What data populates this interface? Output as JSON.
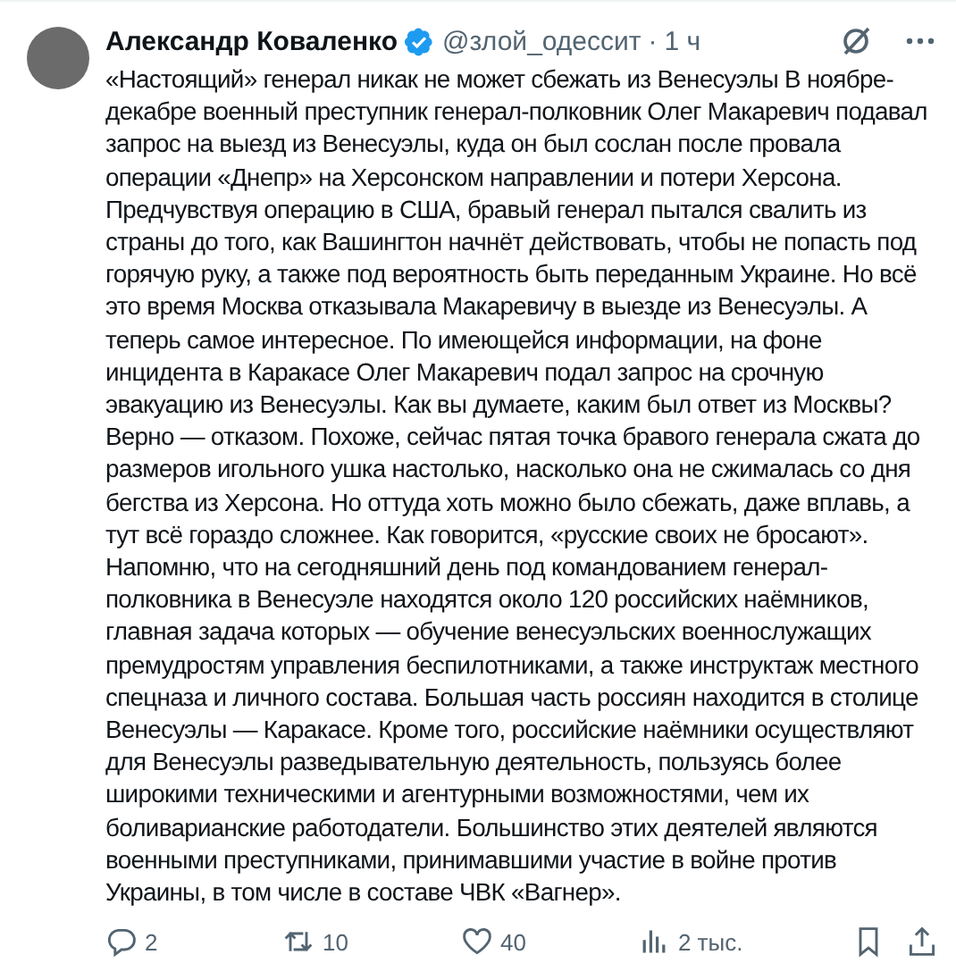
{
  "post": {
    "author": {
      "name": "Александр Коваленко",
      "verified": true,
      "handle": "@злой_одессит",
      "separator": "·",
      "time": "1 ч"
    },
    "text": "«Настоящий» генерал никак не может сбежать из Венесуэлы В ноябре-декабре военный преступник генерал-полковник Олег Макаревич подавал запрос на выезд из Венесуэлы, куда он был сослан после провала операции «Днепр» на Херсонском направлении и потери Херсона. Предчувствуя операцию в США, бравый генерал пытался свалить из страны до того, как Вашингтон начнёт действовать, чтобы не попасть под горячую руку, а также под вероятность быть переданным Украине. Но всё это время Москва отказывала Макаревичу в выезде из Венесуэлы. А теперь самое интересное. По имеющейся информации, на фоне инцидента в Каракасе Олег Макаревич подал запрос на срочную эвакуацию из Венесуэлы. Как вы думаете, каким был ответ из Москвы? Верно — отказом. Похоже, сейчас пятая точка бравого генерала сжата до размеров игольного ушка настолько, насколько она не сжималась со дня бегства из Херсона. Но оттуда хоть можно было сбежать, даже вплавь, а тут всё гораздо сложнее. Как говорится, «русские своих не бросают». Напомню, что на сегодняшний день под командованием генерал-полковника в Венесуэле находятся около 120 российских наёмников, главная задача которых — обучение венесуэльских военнослужащих премудростям управления беспилотниками, а также инструктаж местного спецназа и личного состава. Большая часть россиян находится в столице Венесуэлы — Каракасе. Кроме того, российские наёмники осуществляют для Венесуэлы разведывательную деятельность, пользуясь более широкими техническими и агентурными возможностями, чем их боливарианские работодатели. Большинство этих деятелей являются военными преступниками, принимавшими участие в войне против Украины, в том числе в составе ЧВК «Вагнер».",
    "actions": [
      {
        "kind": "reply",
        "count": "2"
      },
      {
        "kind": "repost",
        "count": "10"
      },
      {
        "kind": "like",
        "count": "40"
      },
      {
        "kind": "views",
        "count": "2 тыс."
      },
      {
        "kind": "bookmark"
      },
      {
        "kind": "share"
      }
    ]
  }
}
